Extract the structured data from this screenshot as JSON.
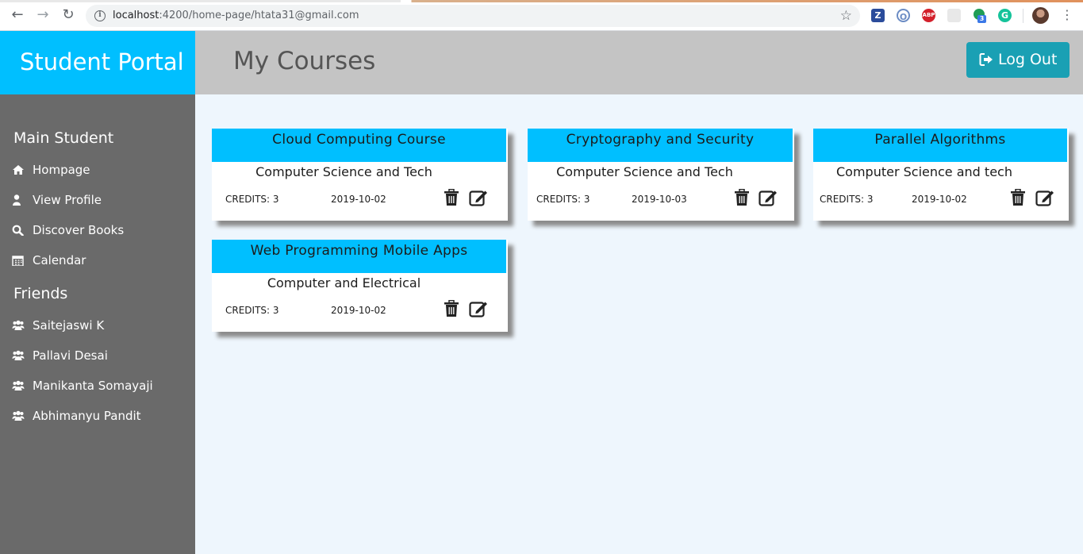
{
  "browser": {
    "url_host": "localhost",
    "url_rest": ":4200/home-page/htata31@gmail.com",
    "extensions": [
      "Z",
      "O",
      "ABP",
      "",
      "3",
      "G"
    ]
  },
  "app": {
    "brand": "Student Portal",
    "page_title": "My Courses",
    "logout_label": "Log Out"
  },
  "sidebar": {
    "main_heading": "Main Student",
    "main_items": [
      {
        "label": "Hompage",
        "icon": "home-icon"
      },
      {
        "label": "View Profile",
        "icon": "user-icon"
      },
      {
        "label": "Discover Books",
        "icon": "search-icon"
      },
      {
        "label": "Calendar",
        "icon": "calendar-icon"
      }
    ],
    "friends_heading": "Friends",
    "friends": [
      {
        "label": "Saitejaswi K",
        "icon": "users-icon"
      },
      {
        "label": "Pallavi Desai",
        "icon": "users-icon"
      },
      {
        "label": "Manikanta Somayaji",
        "icon": "users-icon"
      },
      {
        "label": "Abhimanyu Pandit",
        "icon": "users-icon"
      }
    ]
  },
  "courses": [
    {
      "title": "Cloud Computing Course",
      "department": "Computer Science and Tech",
      "credits": "CREDITS: 3",
      "date": "2019-10-02"
    },
    {
      "title": "Cryptography and Security",
      "department": "Computer Science and Tech",
      "credits": "CREDITS: 3",
      "date": "2019-10-03"
    },
    {
      "title": "Parallel Algorithms",
      "department": "Computer Science and tech",
      "credits": "CREDITS: 3",
      "date": "2019-10-02"
    },
    {
      "title": "Web Programming Mobile Apps",
      "department": "Computer and Electrical",
      "credits": "CREDITS: 3",
      "date": "2019-10-02"
    }
  ],
  "colors": {
    "accent": "#00bfff",
    "header": "#c4c4c4",
    "sidebar": "#6a6a6a",
    "logout": "#1aa0b4",
    "main_bg": "#eef6fd"
  }
}
